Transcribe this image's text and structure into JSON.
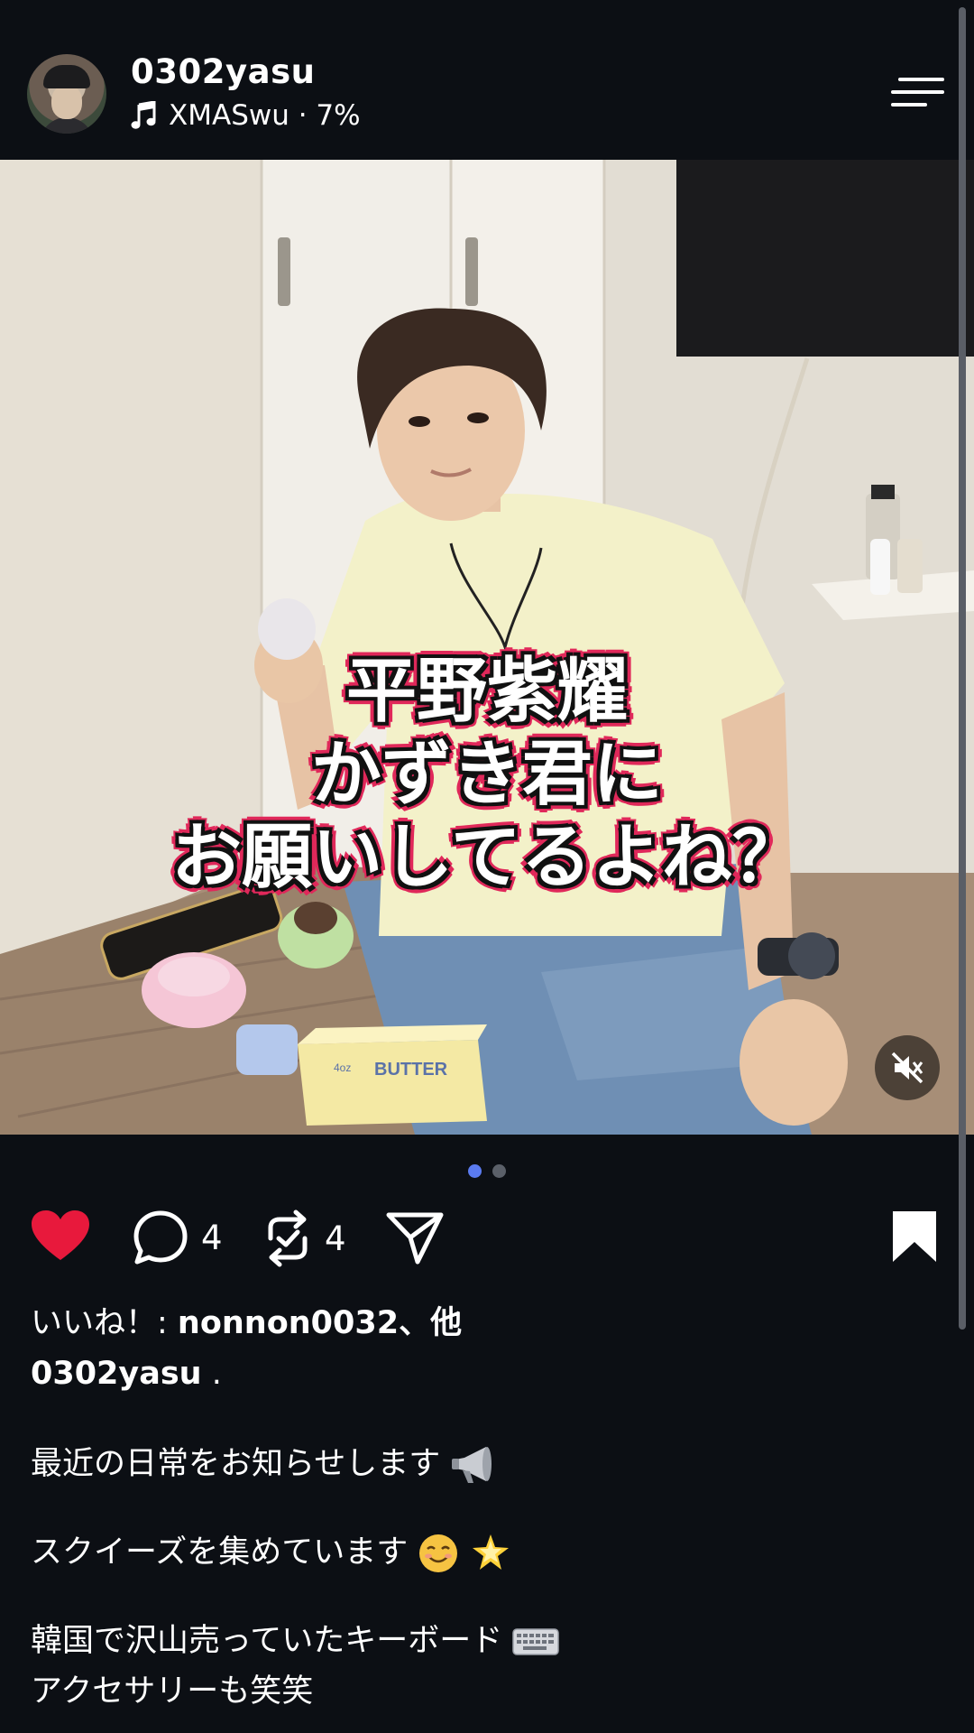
{
  "header": {
    "username": "0302yasu",
    "music_text": "XMASwu · 7%"
  },
  "media": {
    "overlay_lines": [
      "平野紫耀",
      "かずき君に",
      "お願いしてるよね？"
    ],
    "butter_label": "BUTTER",
    "butter_small": "4oz",
    "carousel": {
      "current": 1,
      "total": 2
    }
  },
  "actions": {
    "comment_count": "4",
    "repost_count": "4"
  },
  "post": {
    "likes_prefix": "いいね！: ",
    "likes_user": "nonnon0032",
    "likes_suffix": "、他",
    "author": "0302yasu",
    "author_suffix": " .",
    "line1": "最近の日常をお知らせします",
    "line2": "スクイーズを集めています",
    "line3": "韓国で沢山売っていたキーボード",
    "line4": "アクセサリーも笑笑"
  },
  "colors": {
    "background": "#0c0f14",
    "like_red": "#e8193c",
    "caption_pink": "#e0285a",
    "dot_active": "#5b7bf0"
  },
  "icons": [
    "music-note-icon",
    "menu-icon",
    "mute-icon",
    "heart-icon",
    "comment-icon",
    "repost-icon",
    "send-icon",
    "bookmark-icon",
    "megaphone-icon",
    "smiling-face-icon",
    "star-icon",
    "keyboard-icon"
  ]
}
